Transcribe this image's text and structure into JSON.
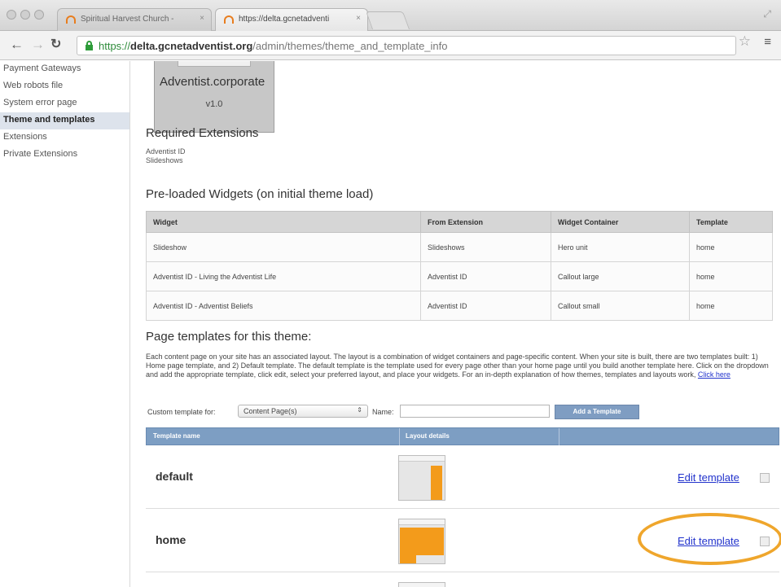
{
  "browser": {
    "tabs": [
      {
        "label": "Spiritual Harvest Church -",
        "active": false
      },
      {
        "label": "https://delta.gcnetadventi",
        "active": true
      }
    ],
    "url": {
      "scheme": "https://",
      "host": "delta.gcnetadventist.org",
      "path": "/admin/themes/theme_and_template_info"
    }
  },
  "sidebar": {
    "items": [
      {
        "label": "Payment Gateways",
        "active": false
      },
      {
        "label": "Web robots file",
        "active": false
      },
      {
        "label": "System error page",
        "active": false
      },
      {
        "label": "Theme and templates",
        "active": true
      },
      {
        "label": "Extensions",
        "active": false
      },
      {
        "label": "Private Extensions",
        "active": false
      }
    ]
  },
  "theme": {
    "name": "Adventist.corporate",
    "version": "v1.0"
  },
  "required_extensions": {
    "heading": "Required Extensions",
    "items": [
      "Adventist ID",
      "Slideshows"
    ]
  },
  "widgets": {
    "heading": "Pre-loaded Widgets (on initial theme load)",
    "columns": [
      "Widget",
      "From Extension",
      "Widget Container",
      "Template"
    ],
    "rows": [
      [
        "Slideshow",
        "Slideshows",
        "Hero unit",
        "home"
      ],
      [
        "Adventist ID - Living the Adventist Life",
        "Adventist ID",
        "Callout large",
        "home"
      ],
      [
        "Adventist ID - Adventist Beliefs",
        "Adventist ID",
        "Callout small",
        "home"
      ]
    ]
  },
  "page_templates": {
    "heading": "Page templates for this theme:",
    "description": "Each content page on your site has an associated layout. The layout is a combination of widget containers and page-specific content. When your site is built, there are two templates built: 1) Home page template, and 2) Default template. The default template is the template used for every page other than your home page until you build another template here. Click on the dropdown and add the appropriate template, click edit, select your preferred layout, and place your widgets. For an in-depth explanation of how themes, templates and layouts work,",
    "click_here": "Click here",
    "custom_label": "Custom template for:",
    "select_value": "Content Page(s)",
    "name_label": "Name:",
    "name_value": "",
    "add_button": "Add a Template",
    "columns": [
      "Template name",
      "Layout details"
    ],
    "rows": [
      {
        "name": "default",
        "edit": "Edit template"
      },
      {
        "name": "home",
        "edit": "Edit template"
      }
    ]
  },
  "colors": {
    "accent_orange": "#f39b1b",
    "highlight_ring": "#efa62c",
    "table_header_blue": "#7d9ec3",
    "link_blue": "#2233cc"
  }
}
